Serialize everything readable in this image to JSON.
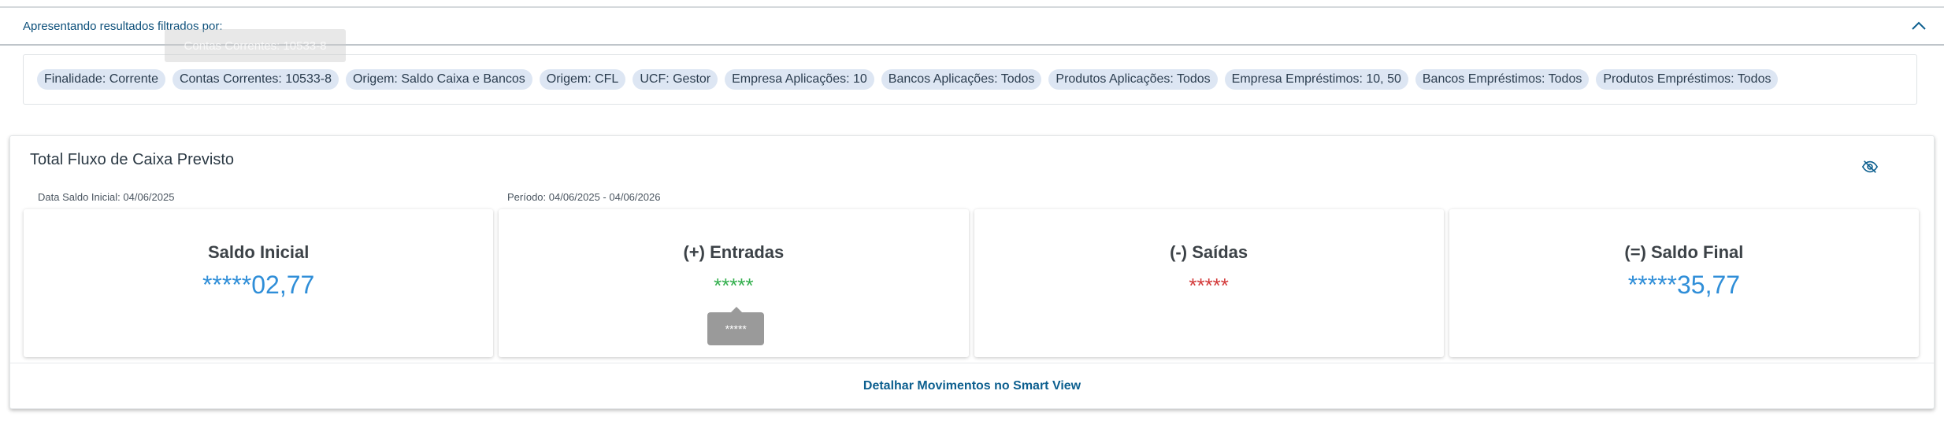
{
  "filters": {
    "title": "Apresentando resultados filtrados por:",
    "chips": [
      "Finalidade: Corrente",
      "Contas Correntes: 10533-8",
      "Origem: Saldo Caixa e Bancos",
      "Origem: CFL",
      "UCF: Gestor",
      "Empresa Aplicações: 10",
      "Bancos Aplicações: Todos",
      "Produtos Aplicações: Todos",
      "Empresa Empréstimos: 10, 50",
      "Bancos Empréstimos: Todos",
      "Produtos Empréstimos: Todos"
    ],
    "tooltip": "Contas Correntes: 10533-8",
    "collapse_icon": "chevron-up-icon"
  },
  "card": {
    "title": "Total Fluxo de Caixa Previsto",
    "hide_values_icon": "eye-off-icon",
    "initial_balance_date": "Data Saldo Inicial: 04/06/2025",
    "period": "Período: 04/06/2025 - 04/06/2026",
    "panels": [
      {
        "label": "Saldo Inicial",
        "value": "*****02,77"
      },
      {
        "label": "(+) Entradas",
        "value": "*****"
      },
      {
        "label": "(-) Saídas",
        "value": "*****"
      },
      {
        "label": "(=) Saldo Final",
        "value": "*****35,77"
      }
    ],
    "value_tooltip": "*****",
    "footer_link": "Detalhar Movimentos no Smart View"
  },
  "colors": {
    "accent": "#0c5f8f",
    "positive": "#35b04f",
    "negative": "#d33a3a",
    "value_blue": "#2f8ed8",
    "chip_bg": "#dde6f3"
  }
}
